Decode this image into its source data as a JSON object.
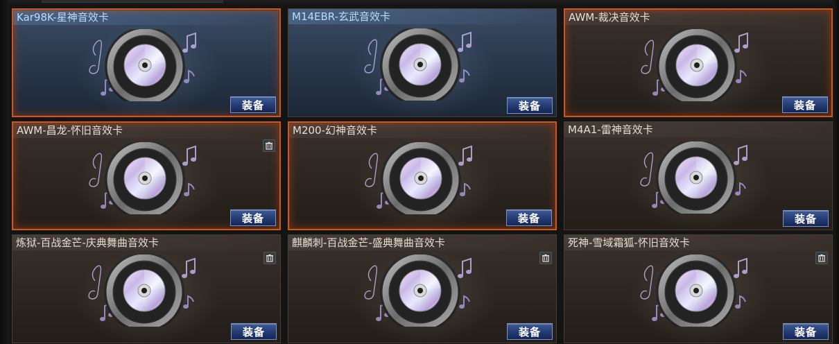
{
  "colors": {
    "selected_border": "#c75a1c",
    "equip_button": "#233a72",
    "blue_title": "#b9dcff",
    "title": "#e8dfd2"
  },
  "cards": [
    {
      "title": "Kar98K-星神音效卡",
      "equip_label": "装备",
      "icon": "music-disc-icon"
    },
    {
      "title": "M14EBR-玄武音效卡",
      "equip_label": "装备",
      "icon": "music-disc-icon"
    },
    {
      "title": "AWM-裁决音效卡",
      "equip_label": "装备",
      "icon": "music-disc-icon"
    },
    {
      "title": "AWM-昌龙-怀旧音效卡",
      "equip_label": "装备",
      "icon": "music-disc-icon",
      "has_delete": true
    },
    {
      "title": "M200-幻神音效卡",
      "equip_label": "装备",
      "icon": "music-disc-icon"
    },
    {
      "title": "M4A1-雷神音效卡",
      "equip_label": "装备",
      "icon": "music-disc-icon"
    },
    {
      "title": "炼狱-百战金芒-庆典舞曲音效卡",
      "equip_label": "装备",
      "icon": "music-disc-icon",
      "has_delete": true
    },
    {
      "title": "麒麟刺-百战金芒-盛典舞曲音效卡",
      "equip_label": "装备",
      "icon": "music-disc-icon",
      "has_delete": true
    },
    {
      "title": "死神-雪域霜狐-怀旧音效卡",
      "equip_label": "装备",
      "icon": "music-disc-icon",
      "has_delete": true
    }
  ]
}
